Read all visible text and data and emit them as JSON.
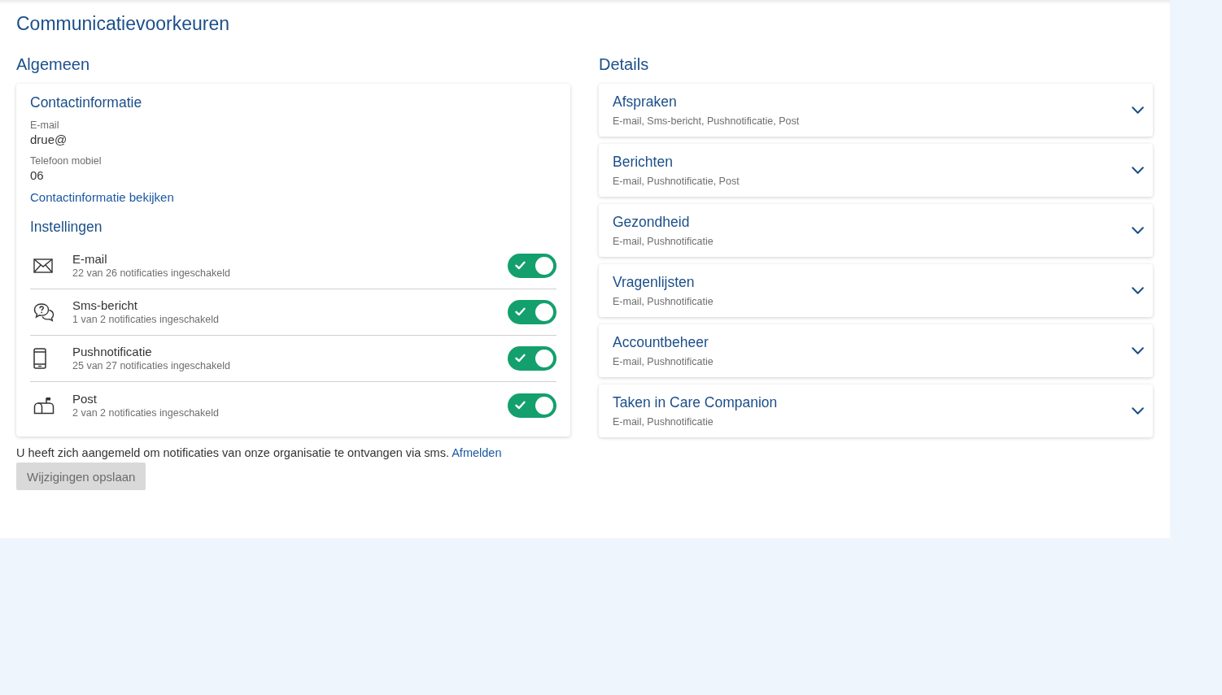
{
  "page": {
    "title": "Communicatievoorkeuren"
  },
  "general": {
    "heading": "Algemeen",
    "contact": {
      "heading": "Contactinformatie",
      "fields": [
        {
          "label": "E-mail",
          "value": "drue@"
        },
        {
          "label": "Telefoon mobiel",
          "value": "06"
        }
      ],
      "link": "Contactinformatie bekijken"
    },
    "settings": {
      "heading": "Instellingen",
      "channels": [
        {
          "kind": "email",
          "name": "E-mail",
          "summary": "22 van 26 notificaties ingeschakeld",
          "on": true
        },
        {
          "kind": "sms",
          "name": "Sms-bericht",
          "summary": "1 van 2 notificaties ingeschakeld",
          "on": true
        },
        {
          "kind": "push",
          "name": "Pushnotificatie",
          "summary": "25 van 27 notificaties ingeschakeld",
          "on": true
        },
        {
          "kind": "post",
          "name": "Post",
          "summary": "2 van 2 notificaties ingeschakeld",
          "on": true
        }
      ]
    },
    "sms_notice": {
      "text": "U heeft zich aangemeld om notificaties van onze organisatie te ontvangen via sms.",
      "link": "Afmelden"
    },
    "save_button": {
      "label": "Wijzigingen opslaan",
      "disabled": true
    }
  },
  "details": {
    "heading": "Details",
    "items": [
      {
        "title": "Afspraken",
        "channels": "E-mail, Sms-bericht, Pushnotificatie, Post",
        "expanded": false
      },
      {
        "title": "Berichten",
        "channels": "E-mail, Pushnotificatie, Post",
        "expanded": false
      },
      {
        "title": "Gezondheid",
        "channels": "E-mail, Pushnotificatie",
        "expanded": false
      },
      {
        "title": "Vragenlijsten",
        "channels": "E-mail, Pushnotificatie",
        "expanded": false
      },
      {
        "title": "Accountbeheer",
        "channels": "E-mail, Pushnotificatie",
        "expanded": false
      },
      {
        "title": "Taken in Care Companion",
        "channels": "E-mail, Pushnotificatie",
        "expanded": false
      }
    ]
  }
}
